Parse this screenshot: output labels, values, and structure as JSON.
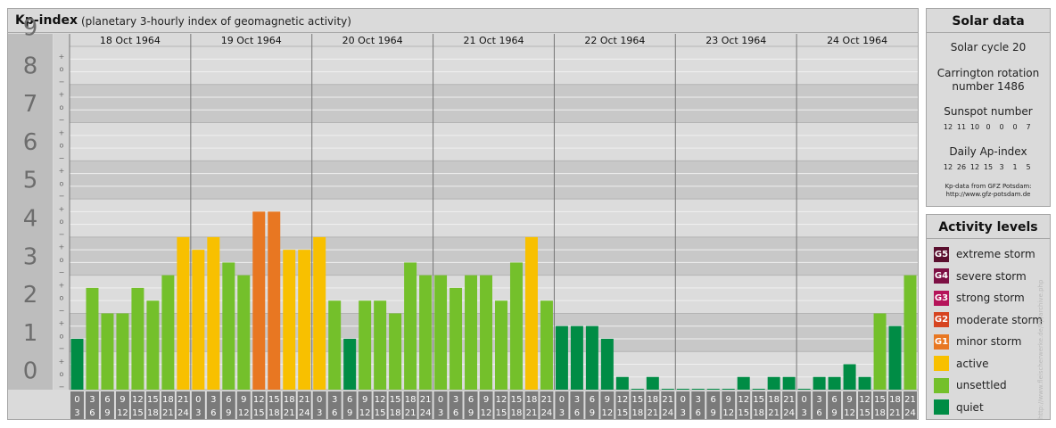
{
  "header": {
    "title": "Kp-index",
    "subtitle": "(planetary 3-hourly index of geomagnetic activity)"
  },
  "solar": {
    "title": "Solar data",
    "cycle": "Solar cycle 20",
    "carrington_line1": "Carrington rotation",
    "carrington_line2": "number 1486",
    "sunspot_title": "Sunspot number",
    "sunspot_values": [
      "12",
      "11",
      "10",
      "0",
      "0",
      "0",
      "7"
    ],
    "ap_title": "Daily Ap-index",
    "ap_values": [
      "12",
      "26",
      "12",
      "15",
      "3",
      "1",
      "5"
    ],
    "source_line1": "Kp-data from GFZ Potsdam:",
    "source_line2": "http://www.gfz-potsdam.de"
  },
  "activity": {
    "title": "Activity levels",
    "items": [
      {
        "badge": "G5",
        "label": "extreme storm",
        "color": "#5a0f2e",
        "icon": "g5-badge-icon"
      },
      {
        "badge": "G4",
        "label": "severe storm",
        "color": "#7d1044",
        "icon": "g4-badge-icon"
      },
      {
        "badge": "G3",
        "label": "strong storm",
        "color": "#b5145a",
        "icon": "g3-badge-icon"
      },
      {
        "badge": "G2",
        "label": "moderate storm",
        "color": "#d64420",
        "icon": "g2-badge-icon"
      },
      {
        "badge": "G1",
        "label": "minor storm",
        "color": "#e87722",
        "icon": "g1-badge-icon"
      },
      {
        "badge": "",
        "label": "active",
        "color": "#f8c000",
        "icon": "active-swatch-icon"
      },
      {
        "badge": "",
        "label": "unsettled",
        "color": "#74c02b",
        "icon": "unsettled-swatch-icon"
      },
      {
        "badge": "",
        "label": "quiet",
        "color": "#008c45",
        "icon": "quiet-swatch-icon"
      }
    ]
  },
  "watermark": "http://www.fleischerwerke.de/kp/archive.php",
  "chart_data": {
    "type": "bar",
    "days": [
      "18 Oct 1964",
      "19 Oct 1964",
      "20 Oct 1964",
      "21 Oct 1964",
      "22 Oct 1964",
      "23 Oct 1964",
      "24 Oct 1964"
    ],
    "slot_starts": [
      "0",
      "3",
      "6",
      "9",
      "12",
      "15",
      "18",
      "21"
    ],
    "slot_ends": [
      "3",
      "6",
      "9",
      "12",
      "15",
      "18",
      "21",
      "24"
    ],
    "y_labels": [
      "0",
      "1",
      "2",
      "3",
      "4",
      "5",
      "6",
      "7",
      "8",
      "9"
    ],
    "thirds_labels": [
      "−",
      "o",
      "+"
    ],
    "ylim": [
      0,
      9
    ],
    "values": [
      1.333,
      2.667,
      2.0,
      2.0,
      2.667,
      2.333,
      3.0,
      4.0,
      3.667,
      4.0,
      3.333,
      3.0,
      4.667,
      4.667,
      3.667,
      3.667,
      4.0,
      2.333,
      1.333,
      2.333,
      2.333,
      2.0,
      3.333,
      3.0,
      3.0,
      2.667,
      3.0,
      3.0,
      2.333,
      3.333,
      4.0,
      2.333,
      1.667,
      1.667,
      1.667,
      1.333,
      0.333,
      0.0,
      0.333,
      0.0,
      0.0,
      0.0,
      0.0,
      0.0,
      0.333,
      0.0,
      0.333,
      0.333,
      0.0,
      0.333,
      0.333,
      0.667,
      0.333,
      2.0,
      1.667,
      3.0
    ],
    "colors": {
      "quiet": "#008c45",
      "unsettled": "#74c02b",
      "active": "#f8c000",
      "g1": "#e87722",
      "g2": "#d64420"
    }
  }
}
